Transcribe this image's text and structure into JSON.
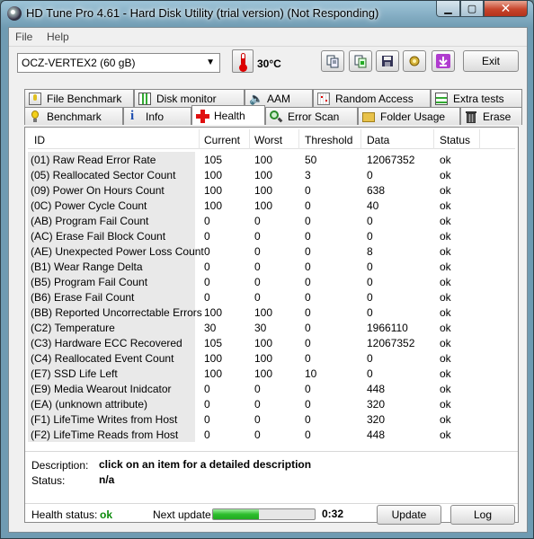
{
  "window": {
    "title": "HD Tune Pro 4.61 - Hard Disk Utility (trial version) (Not Responding)"
  },
  "menu": {
    "file": "File",
    "help": "Help"
  },
  "toolbar": {
    "drive": "OCZ-VERTEX2 (60 gB)",
    "temperature": "30°C",
    "exit_label": "Exit",
    "tool_icons": [
      "copy-icon",
      "copy-info-icon",
      "save-icon",
      "options-icon",
      "download-icon"
    ]
  },
  "tabs": {
    "row1": [
      "File Benchmark",
      "Disk monitor",
      "AAM",
      "Random Access",
      "Extra tests"
    ],
    "row2": [
      "Benchmark",
      "Info",
      "Health",
      "Error Scan",
      "Folder Usage",
      "Erase"
    ],
    "active": "Health"
  },
  "health": {
    "columns": [
      "ID",
      "Current",
      "Worst",
      "Threshold",
      "Data",
      "Status"
    ],
    "rows": [
      {
        "id": "(01) Raw Read Error Rate",
        "current": "105",
        "worst": "100",
        "threshold": "50",
        "data": "12067352",
        "status": "ok"
      },
      {
        "id": "(05) Reallocated Sector Count",
        "current": "100",
        "worst": "100",
        "threshold": "3",
        "data": "0",
        "status": "ok"
      },
      {
        "id": "(09) Power On Hours Count",
        "current": "100",
        "worst": "100",
        "threshold": "0",
        "data": "638",
        "status": "ok"
      },
      {
        "id": "(0C) Power Cycle Count",
        "current": "100",
        "worst": "100",
        "threshold": "0",
        "data": "40",
        "status": "ok"
      },
      {
        "id": "(AB) Program Fail Count",
        "current": "0",
        "worst": "0",
        "threshold": "0",
        "data": "0",
        "status": "ok"
      },
      {
        "id": "(AC) Erase Fail Block Count",
        "current": "0",
        "worst": "0",
        "threshold": "0",
        "data": "0",
        "status": "ok"
      },
      {
        "id": "(AE) Unexpected Power Loss Count",
        "current": "0",
        "worst": "0",
        "threshold": "0",
        "data": "8",
        "status": "ok"
      },
      {
        "id": "(B1) Wear Range Delta",
        "current": "0",
        "worst": "0",
        "threshold": "0",
        "data": "0",
        "status": "ok"
      },
      {
        "id": "(B5) Program Fail Count",
        "current": "0",
        "worst": "0",
        "threshold": "0",
        "data": "0",
        "status": "ok"
      },
      {
        "id": "(B6) Erase Fail Count",
        "current": "0",
        "worst": "0",
        "threshold": "0",
        "data": "0",
        "status": "ok"
      },
      {
        "id": "(BB) Reported Uncorrectable Errors",
        "current": "100",
        "worst": "100",
        "threshold": "0",
        "data": "0",
        "status": "ok"
      },
      {
        "id": "(C2) Temperature",
        "current": "30",
        "worst": "30",
        "threshold": "0",
        "data": "1966110",
        "status": "ok"
      },
      {
        "id": "(C3) Hardware ECC Recovered",
        "current": "105",
        "worst": "100",
        "threshold": "0",
        "data": "12067352",
        "status": "ok"
      },
      {
        "id": "(C4) Reallocated Event Count",
        "current": "100",
        "worst": "100",
        "threshold": "0",
        "data": "0",
        "status": "ok"
      },
      {
        "id": "(E7) SSD Life Left",
        "current": "100",
        "worst": "100",
        "threshold": "10",
        "data": "0",
        "status": "ok"
      },
      {
        "id": "(E9) Media Wearout Inidcator",
        "current": "0",
        "worst": "0",
        "threshold": "0",
        "data": "448",
        "status": "ok"
      },
      {
        "id": "(EA) (unknown attribute)",
        "current": "0",
        "worst": "0",
        "threshold": "0",
        "data": "320",
        "status": "ok"
      },
      {
        "id": "(F1) LifeTime Writes from Host",
        "current": "0",
        "worst": "0",
        "threshold": "0",
        "data": "320",
        "status": "ok"
      },
      {
        "id": "(F2) LifeTime Reads from Host",
        "current": "0",
        "worst": "0",
        "threshold": "0",
        "data": "448",
        "status": "ok"
      }
    ]
  },
  "details": {
    "description_label": "Description:",
    "description_value": "click on an item for a detailed description",
    "status_label": "Status:",
    "status_value": "n/a"
  },
  "footer": {
    "health_status_label": "Health status:",
    "health_status_value": "ok",
    "next_update_label": "Next update:",
    "progress_fraction": 0.45,
    "countdown": "0:32",
    "update_label": "Update",
    "log_label": "Log"
  },
  "colors": {
    "ok_green": "#0a8a0a",
    "progress_green": "#2dbe2d",
    "close_red": "#c7452c"
  }
}
